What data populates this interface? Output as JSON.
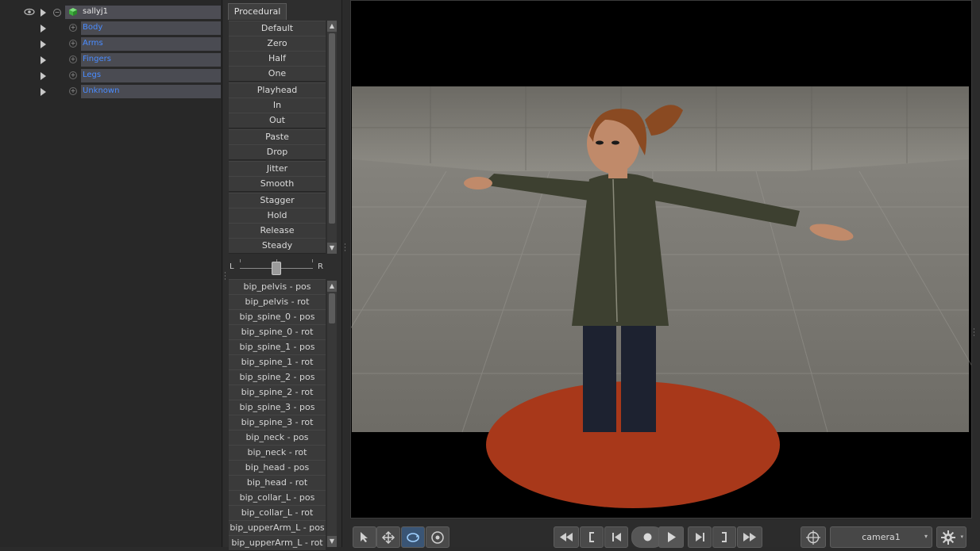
{
  "tree": {
    "root": {
      "label": "sallyj1",
      "icons": [
        "eye-icon",
        "cube-icon"
      ]
    },
    "groups": [
      {
        "label": "Body"
      },
      {
        "label": "Arms"
      },
      {
        "label": "Fingers"
      },
      {
        "label": "Legs"
      },
      {
        "label": "Unknown"
      }
    ]
  },
  "procedural": {
    "tab_label": "Procedural",
    "buttons": [
      "Default",
      "Zero",
      "Half",
      "One",
      "Playhead",
      "In",
      "Out",
      "Paste",
      "Drop",
      "Jitter",
      "Smooth",
      "Stagger",
      "Hold",
      "Release",
      "Steady"
    ],
    "slider": {
      "left_label": "L",
      "right_label": "R",
      "value": 0.5
    }
  },
  "bones": [
    "bip_pelvis - pos",
    "bip_pelvis - rot",
    "bip_spine_0 - pos",
    "bip_spine_0 - rot",
    "bip_spine_1 - pos",
    "bip_spine_1 - rot",
    "bip_spine_2 - pos",
    "bip_spine_2 - rot",
    "bip_spine_3 - pos",
    "bip_spine_3 - rot",
    "bip_neck - pos",
    "bip_neck - rot",
    "bip_head - pos",
    "bip_head - rot",
    "bip_collar_L - pos",
    "bip_collar_L - rot",
    "bip_upperArm_L - pos",
    "bip_upperArm_L - rot"
  ],
  "viewport": {
    "camera_select": "camera1",
    "colors": {
      "wall": "#8a8880",
      "floor": "#7e7c75",
      "disc": "#a8381a",
      "jacket": "#3d4030",
      "pants": "#1d2230",
      "hair": "#8a4a22",
      "skin": "#c08a6a"
    }
  },
  "toolbar": {
    "left_tools": [
      "select-icon",
      "move-icon",
      "rotate-icon",
      "orbit-icon"
    ],
    "transport": [
      "rewind-icon",
      "mark-in-icon",
      "step-back-icon",
      "record-icon",
      "play-icon",
      "step-forward-icon",
      "mark-out-icon",
      "fast-forward-icon"
    ],
    "right_tools": [
      "target-icon",
      "gear-icon"
    ]
  }
}
